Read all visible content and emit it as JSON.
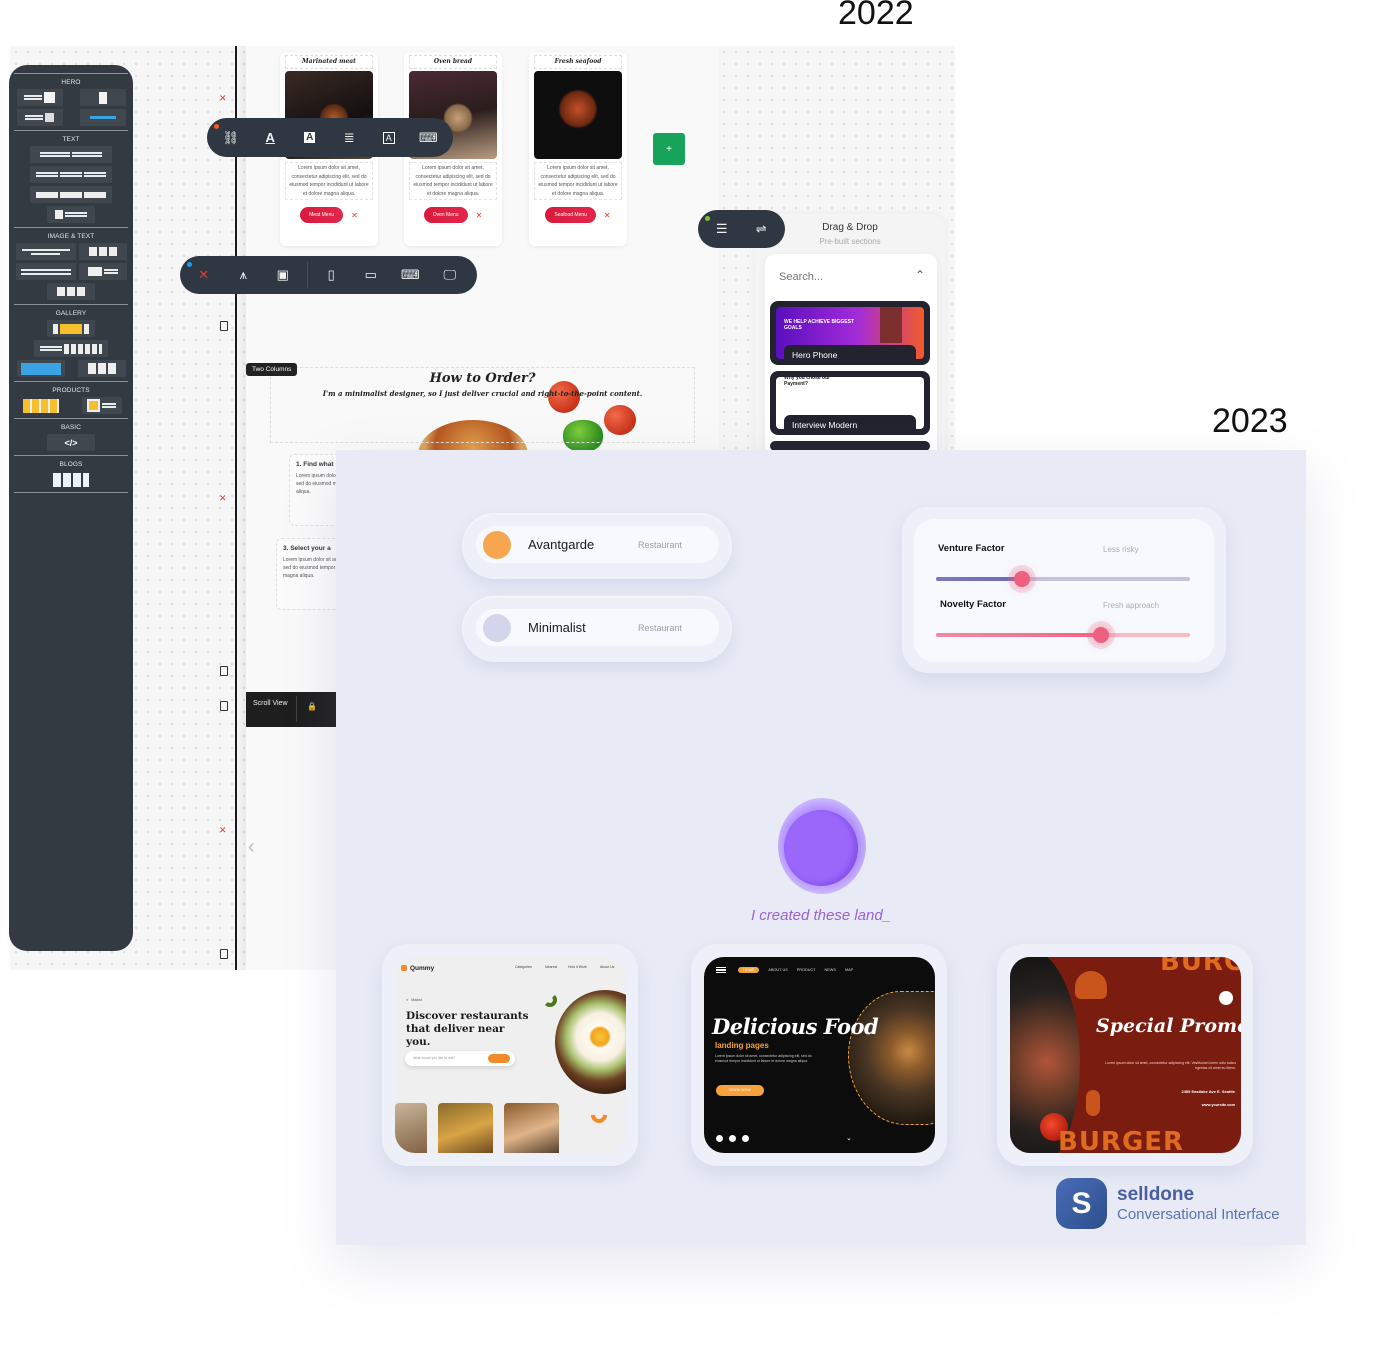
{
  "labels": {
    "year_old": "2022",
    "year_new": "2023"
  },
  "builder": {
    "sidebar": {
      "sections": [
        {
          "title": "HERO"
        },
        {
          "title": "TEXT"
        },
        {
          "title": "IMAGE & TEXT"
        },
        {
          "title": "GALLERY"
        },
        {
          "title": "PRODUCTS"
        },
        {
          "title": "BASIC"
        },
        {
          "title": "BLOGS"
        }
      ]
    },
    "food_cards": [
      {
        "title": "Marinated meat",
        "desc": "Lorem ipsum dolor sit amet, consectetur adipiscing elit, sed do eiusmod tempor incididunt ut labore et dolore magna aliqua.",
        "button": "Meat Menu"
      },
      {
        "title": "Oven bread",
        "desc": "Lorem ipsum dolor sit amet, consectetur adipiscing elit, sed do eiusmod tempor incididunt ut labore et dolore magna aliqua.",
        "button": "Oven Menu"
      },
      {
        "title": "Fresh seafood",
        "desc": "Lorem ipsum dolor sit amet, consectetur adipiscing elit, sed do eiusmod tempor incididunt ut labore et dolore magna aliqua.",
        "button": "Seafood Menu"
      }
    ],
    "format_toolbar": {
      "icons": [
        "link-icon",
        "text-color-icon",
        "text-background-icon",
        "align-icon",
        "text-box-icon",
        "keyboard-icon"
      ]
    },
    "section_toolbar": {
      "icons": [
        "close-icon",
        "compass-icon",
        "image-icon",
        "mobile-icon",
        "tablet-icon",
        "laptop-icon",
        "desktop-icon"
      ]
    },
    "add_button": "+",
    "drag_drop": {
      "title": "Drag & Drop",
      "subtitle": "Pre-built sections",
      "search_placeholder": "Search...",
      "items": [
        {
          "label": "Hero Phone",
          "preview_text": "WE HELP ACHIEVE BIGGEST GOALS"
        },
        {
          "label": "Interview Modern",
          "preview_text": "Why you chose our Payment?"
        }
      ]
    },
    "two_columns_tag": "Two Columns",
    "how_to_order": {
      "title": "How to Order?",
      "subtitle": "I'm a minimalist designer, so I just deliver crucial and right-to-the-point content."
    },
    "steps": [
      {
        "title": "1. Find what",
        "desc": "Lorem ipsum dolor sit amet, sed do eiusmod magna aliqua."
      },
      {
        "title": "3. Select your a",
        "desc": "Lorem ipsum dolor sit amet, sed do eiusmod tempor magna aliqua."
      }
    ],
    "scroll_view_label": "Scroll View"
  },
  "conversational": {
    "styles": [
      {
        "name": "Avantgarde",
        "category": "Restaurant",
        "color": "#f7a54f"
      },
      {
        "name": "Minimalist",
        "category": "Restaurant",
        "color": "#d3d5ea"
      }
    ],
    "factors": [
      {
        "label": "Venture Factor",
        "hint": "Less risky",
        "value": 0.34
      },
      {
        "label": "Novelty Factor",
        "hint": "Fresh approach",
        "value": 0.65
      }
    ],
    "typing_text": "I created these land_",
    "previews": [
      {
        "brand": "Qummy",
        "nav": [
          "Categories",
          "Nearest",
          "How it Work",
          "About Us"
        ],
        "location": "Madrid",
        "headline": "Discover restaurants that deliver near you.",
        "search_placeholder": "what would you like to eat?"
      },
      {
        "nav": [
          "HOME",
          "ABOUT US",
          "PRODUCT",
          "NEWS",
          "MAP"
        ],
        "title": "Delicious Food",
        "subtitle": "landing pages",
        "body": "Lorem ipsum dolor sit amet, consectetur adipiscing elit, sed do eiusmod tempor incididunt ut labore et dolore magna aliqua.",
        "button": "BOOK NOW"
      },
      {
        "top_word": "BURG",
        "title": "Special Promo",
        "body": "Lorem ipsum dolor sit amet, consectetur adipiscing elit. Vestibulum lorem odio luctus egestas sit amet eu libero.",
        "address": "2459 Eastlake Ave E. Seattle",
        "website": "www.yoursite.com",
        "bottom_word": "BURGER"
      }
    ],
    "brand": {
      "name": "selldone",
      "tagline": "Conversational Interface",
      "logo_letter": "S"
    }
  }
}
